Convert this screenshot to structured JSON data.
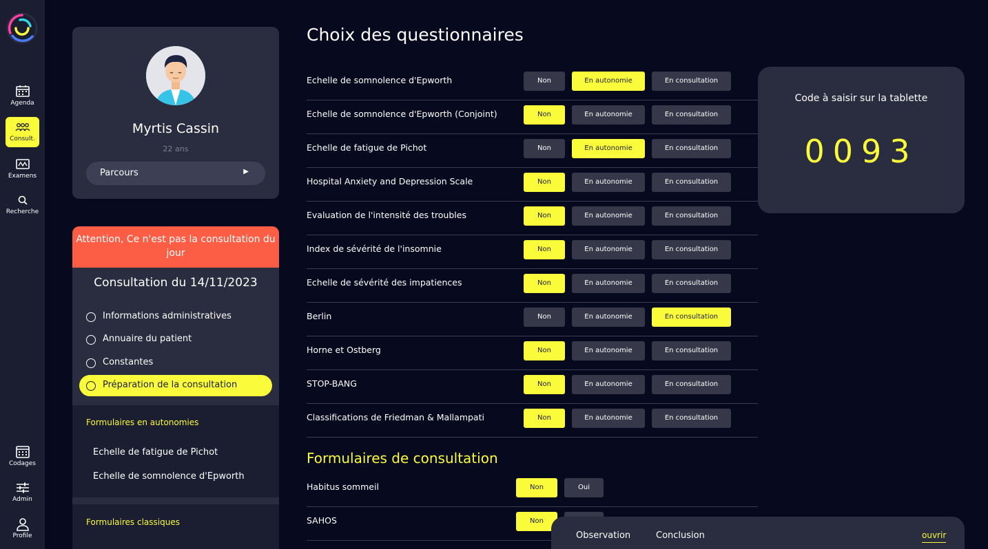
{
  "nav": {
    "items": [
      {
        "label": "Agenda",
        "icon": "calendar-icon"
      },
      {
        "label": "Consult.",
        "icon": "people-icon"
      },
      {
        "label": "Examens",
        "icon": "chart-icon"
      },
      {
        "label": "Recherche",
        "icon": "search-icon"
      },
      {
        "label": "Codages",
        "icon": "codages-icon"
      },
      {
        "label": "Admin",
        "icon": "sliders-icon"
      },
      {
        "label": "Profile",
        "icon": "user-icon"
      }
    ],
    "active": "Consult."
  },
  "patient": {
    "name": "Myrtis Cassin",
    "age": "22 ans",
    "parcours_label": "Parcours",
    "parcours_arrow": "▶"
  },
  "consultation": {
    "warning": "Attention, Ce n'est pas la consultation du jour",
    "title": "Consultation du 14/11/2023",
    "steps": [
      {
        "label": "Informations administratives",
        "active": false
      },
      {
        "label": "Annuaire du patient",
        "active": false
      },
      {
        "label": "Constantes",
        "active": false
      },
      {
        "label": "Préparation de la consultation",
        "active": true
      }
    ],
    "autonomy_heading": "Formulaires en autonomies",
    "autonomy_forms": [
      "Echelle de fatigue de Pichot",
      "Echelle de somnolence d'Epworth"
    ],
    "classic_heading": "Formulaires classiques"
  },
  "main": {
    "title": "Choix des questionnaires",
    "button_labels": {
      "non": "Non",
      "auto": "En autonomie",
      "cons": "En consultation",
      "oui": "Oui"
    },
    "questionnaires": [
      {
        "label": "Echelle de somnolence d'Epworth",
        "selected": "auto"
      },
      {
        "label": "Echelle de somnolence d'Epworth (Conjoint)",
        "selected": "non"
      },
      {
        "label": "Echelle de fatigue de Pichot",
        "selected": "auto"
      },
      {
        "label": "Hospital Anxiety and Depression Scale",
        "selected": "non"
      },
      {
        "label": "Evaluation de l'intensité des troubles",
        "selected": "non"
      },
      {
        "label": "Index de sévérité de l'insomnie",
        "selected": "non"
      },
      {
        "label": "Echelle de sévérité des impatiences",
        "selected": "non"
      },
      {
        "label": "Berlin",
        "selected": "cons"
      },
      {
        "label": "Horne et Ostberg",
        "selected": "non"
      },
      {
        "label": "STOP-BANG",
        "selected": "non"
      },
      {
        "label": "Classifications de Friedman & Mallampati",
        "selected": "non"
      }
    ],
    "consultation_forms_title": "Formulaires de consultation",
    "consultation_forms": [
      {
        "label": "Habitus sommeil",
        "selected": "non"
      },
      {
        "label": "SAHOS",
        "selected": "non"
      }
    ]
  },
  "tablet": {
    "label": "Code à saisir sur la tablette",
    "code": "0093"
  },
  "bottom_panel": {
    "tabs": [
      "Observation",
      "Conclusion"
    ],
    "open_label": "ouvrir"
  },
  "colors": {
    "accent": "#fafb3a",
    "warning": "#fb5e45",
    "background": "#070a1f",
    "panel": "#2a2c3f"
  }
}
